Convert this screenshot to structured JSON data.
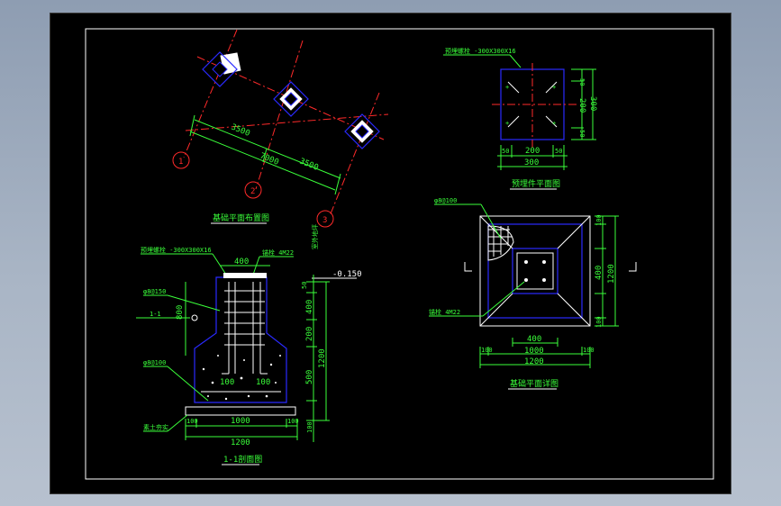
{
  "titles": {
    "plan": "基础平面布置图",
    "embed": "预埋件平面图",
    "section": "1-1剖面图",
    "detail": "基础平面详图"
  },
  "grid": {
    "axis1": "1",
    "axis2": "2",
    "axis3": "3",
    "span_a": "3500",
    "span_b": "3500",
    "total": "7000"
  },
  "embed": {
    "note": "预埋螺栓 -300X300X16",
    "dim_h": [
      "50",
      "200",
      "50"
    ],
    "dim_h_total": "300",
    "dim_v": [
      "50",
      "200",
      "50"
    ],
    "dim_v_total": "300"
  },
  "section": {
    "note_top": "预埋螺栓 -300X300X16",
    "note_anchor": "锚栓 4M22",
    "note_elev": "室外地坪",
    "elev": "-0.150",
    "phi_a": "φ8@150",
    "phi_b": "φ8@100",
    "phi_c": "φ8@100",
    "note_pad": "素土夯实",
    "dim_top": "400",
    "dim_left": "800",
    "dim_inner_l": "100",
    "dim_inner_r": "100",
    "dim_bot": [
      "100",
      "1000",
      "100"
    ],
    "dim_bot_total": "1200",
    "dim_right": [
      "50",
      "400",
      "200",
      "500",
      "100"
    ],
    "dim_right_total": "1200",
    "arrow_label": "1-1"
  },
  "detail": {
    "phi": "φ8@100",
    "note_anchor": "锚栓 4M22",
    "dim_inner": "400",
    "dim_mid": "1000",
    "dim_side_l": "100",
    "dim_side_r": "100",
    "dim_total": "1200",
    "dim_r": [
      "100",
      "400",
      "100"
    ],
    "dim_r_total": "1200"
  }
}
